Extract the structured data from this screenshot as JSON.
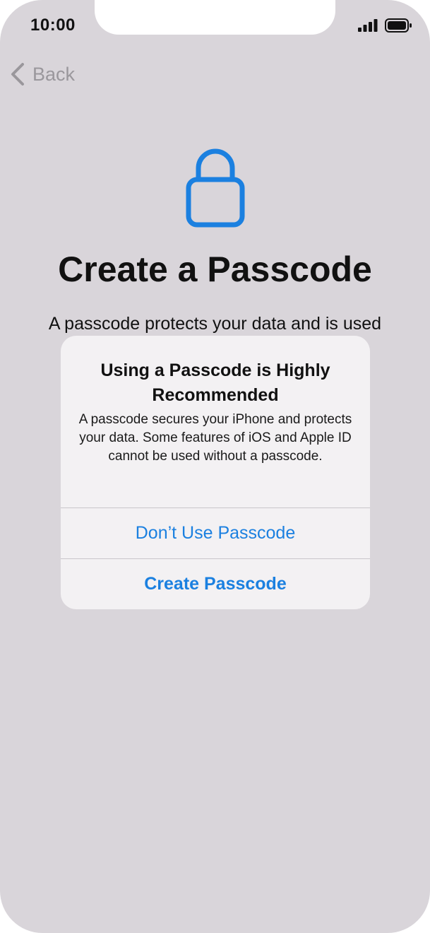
{
  "status_bar": {
    "time": "10:00",
    "icons": [
      "cellular-signal-icon",
      "battery-icon"
    ]
  },
  "nav": {
    "back_label": "Back",
    "back_icon": "chevron-left-icon"
  },
  "header": {
    "icon": "lock-icon",
    "title": "Create a Passcode",
    "subtitle": "A passcode protects your data and is used"
  },
  "alert": {
    "title": "Using a Passcode is Highly Recommended",
    "message": "A passcode secures your iPhone and protects your data. Some features of iOS and Apple ID cannot be used without a passcode.",
    "buttons": [
      {
        "label": "Don’t Use Passcode",
        "style": "default"
      },
      {
        "label": "Create Passcode",
        "style": "preferred"
      }
    ]
  },
  "colors": {
    "background": "#d9d5da",
    "accent": "#1b80e0",
    "alert_background": "#f3f1f3",
    "back_gray": "#9a979c"
  }
}
